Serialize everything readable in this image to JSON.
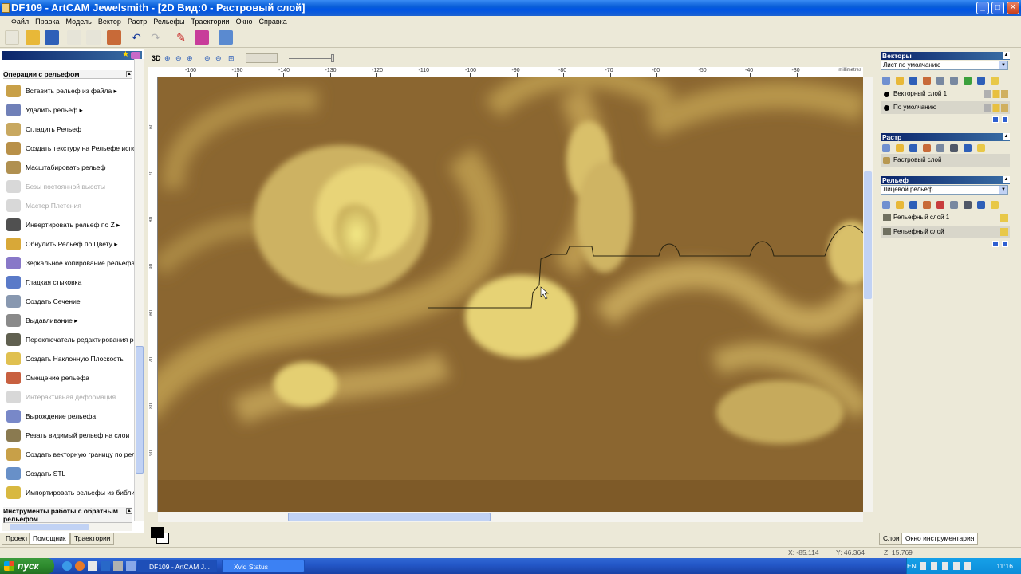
{
  "window": {
    "title": "DF109 - ArtCAM Jewelsmith - [2D Вид:0 - Растровый слой]",
    "controls": {
      "minimize": "_",
      "maximize": "□",
      "close": "✕"
    }
  },
  "menu": [
    "Файл",
    "Правка",
    "Модель",
    "Вектор",
    "Растр",
    "Рельефы",
    "Траектории",
    "Окно",
    "Справка"
  ],
  "left_panel": {
    "section1_title": "Операции с рельефом",
    "operations": [
      {
        "label": "Вставить рельеф из файла ▸",
        "enabled": true,
        "icon": "relief-insert-icon"
      },
      {
        "label": "Удалить рельеф ▸",
        "enabled": true,
        "icon": "relief-delete-icon"
      },
      {
        "label": "Сгладить Рельеф",
        "enabled": true,
        "icon": "relief-smooth-icon"
      },
      {
        "label": "Создать текстуру на Рельефе испо",
        "enabled": true,
        "icon": "relief-texture-icon"
      },
      {
        "label": "Масштабировать рельеф",
        "enabled": true,
        "icon": "relief-scale-icon"
      },
      {
        "label": "Безы постоянной высоты",
        "enabled": false,
        "icon": "constant-height-icon"
      },
      {
        "label": "Мастер Плетения",
        "enabled": false,
        "icon": "weave-wizard-icon"
      },
      {
        "label": "Инвертировать рельеф по Z ▸",
        "enabled": true,
        "icon": "relief-invert-icon"
      },
      {
        "label": "Обнулить Рельеф по Цвету ▸",
        "enabled": true,
        "icon": "relief-zero-color-icon"
      },
      {
        "label": "Зеркальное копирование рельефа",
        "enabled": true,
        "icon": "relief-mirror-icon"
      },
      {
        "label": "Гладкая стыковка",
        "enabled": true,
        "icon": "smooth-join-icon"
      },
      {
        "label": "Создать Сечение",
        "enabled": true,
        "icon": "create-section-icon"
      },
      {
        "label": "Выдавливание ▸",
        "enabled": true,
        "icon": "extrude-icon"
      },
      {
        "label": "Переключатель редактирования ре",
        "enabled": true,
        "icon": "edit-toggle-icon"
      },
      {
        "label": "Создать Наклонную Плоскость",
        "enabled": true,
        "icon": "inclined-plane-icon"
      },
      {
        "label": "Смещение рельефа",
        "enabled": true,
        "icon": "relief-offset-icon"
      },
      {
        "label": "Интерактивная деформация",
        "enabled": false,
        "icon": "interactive-deform-icon"
      },
      {
        "label": "Вырождение рельефа",
        "enabled": true,
        "icon": "relief-degenerate-icon"
      },
      {
        "label": "Резать видимый рельеф на слои",
        "enabled": true,
        "icon": "relief-slice-icon"
      },
      {
        "label": "Создать векторную границу по рель",
        "enabled": true,
        "icon": "vector-boundary-icon"
      },
      {
        "label": "Создать STL",
        "enabled": true,
        "icon": "stl-icon"
      },
      {
        "label": "Импортировать рельефы из библи",
        "enabled": true,
        "icon": "relief-import-icon"
      }
    ],
    "section2_title": "Инструменты работы с обратным рельефом",
    "tabs": [
      "Проект",
      "Помощник",
      "Траектории"
    ],
    "active_tab": "Помощник"
  },
  "view": {
    "mode_label": "3D",
    "ruler_h_ticks": [
      "-160",
      "-150",
      "-140",
      "-130",
      "-120",
      "-110",
      "-100",
      "-90",
      "-80",
      "-70",
      "-60",
      "-50",
      "-40",
      "-30"
    ],
    "ruler_v_ticks": [
      "60",
      "70",
      "80",
      "90",
      "60",
      "70",
      "80",
      "90"
    ],
    "ruler_unit": "millimetres",
    "canvas_bg": "#8B6630",
    "relief_color": "#E8D878"
  },
  "right_panel": {
    "vectors": {
      "title": "Векторы",
      "sheet": "Лист по умолчанию",
      "layers": [
        {
          "name": "Векторный слой 1",
          "selected": false
        },
        {
          "name": "По умолчанию",
          "selected": true
        }
      ]
    },
    "raster": {
      "title": "Растр",
      "layers": [
        {
          "name": "Растровый слой",
          "selected": true
        }
      ]
    },
    "relief": {
      "title": "Рельеф",
      "mode": "Лицевой рельеф",
      "layers": [
        {
          "name": "Рельефный слой 1",
          "selected": false
        },
        {
          "name": "Рельефный слой",
          "selected": true
        }
      ]
    },
    "tabs": [
      "Слои",
      "Окно инструментария"
    ],
    "active_tab": "Окно инструментария"
  },
  "status": {
    "x": "X: -85.114",
    "y": "Y: 46.364",
    "z": "Z: 15.769"
  },
  "taskbar": {
    "start": "пуск",
    "tasks": [
      {
        "label": "DF109 - ArtCAM J...",
        "active": true
      },
      {
        "label": "Xvid Status",
        "active": false
      }
    ],
    "lang": "EN",
    "clock": "11:16"
  }
}
